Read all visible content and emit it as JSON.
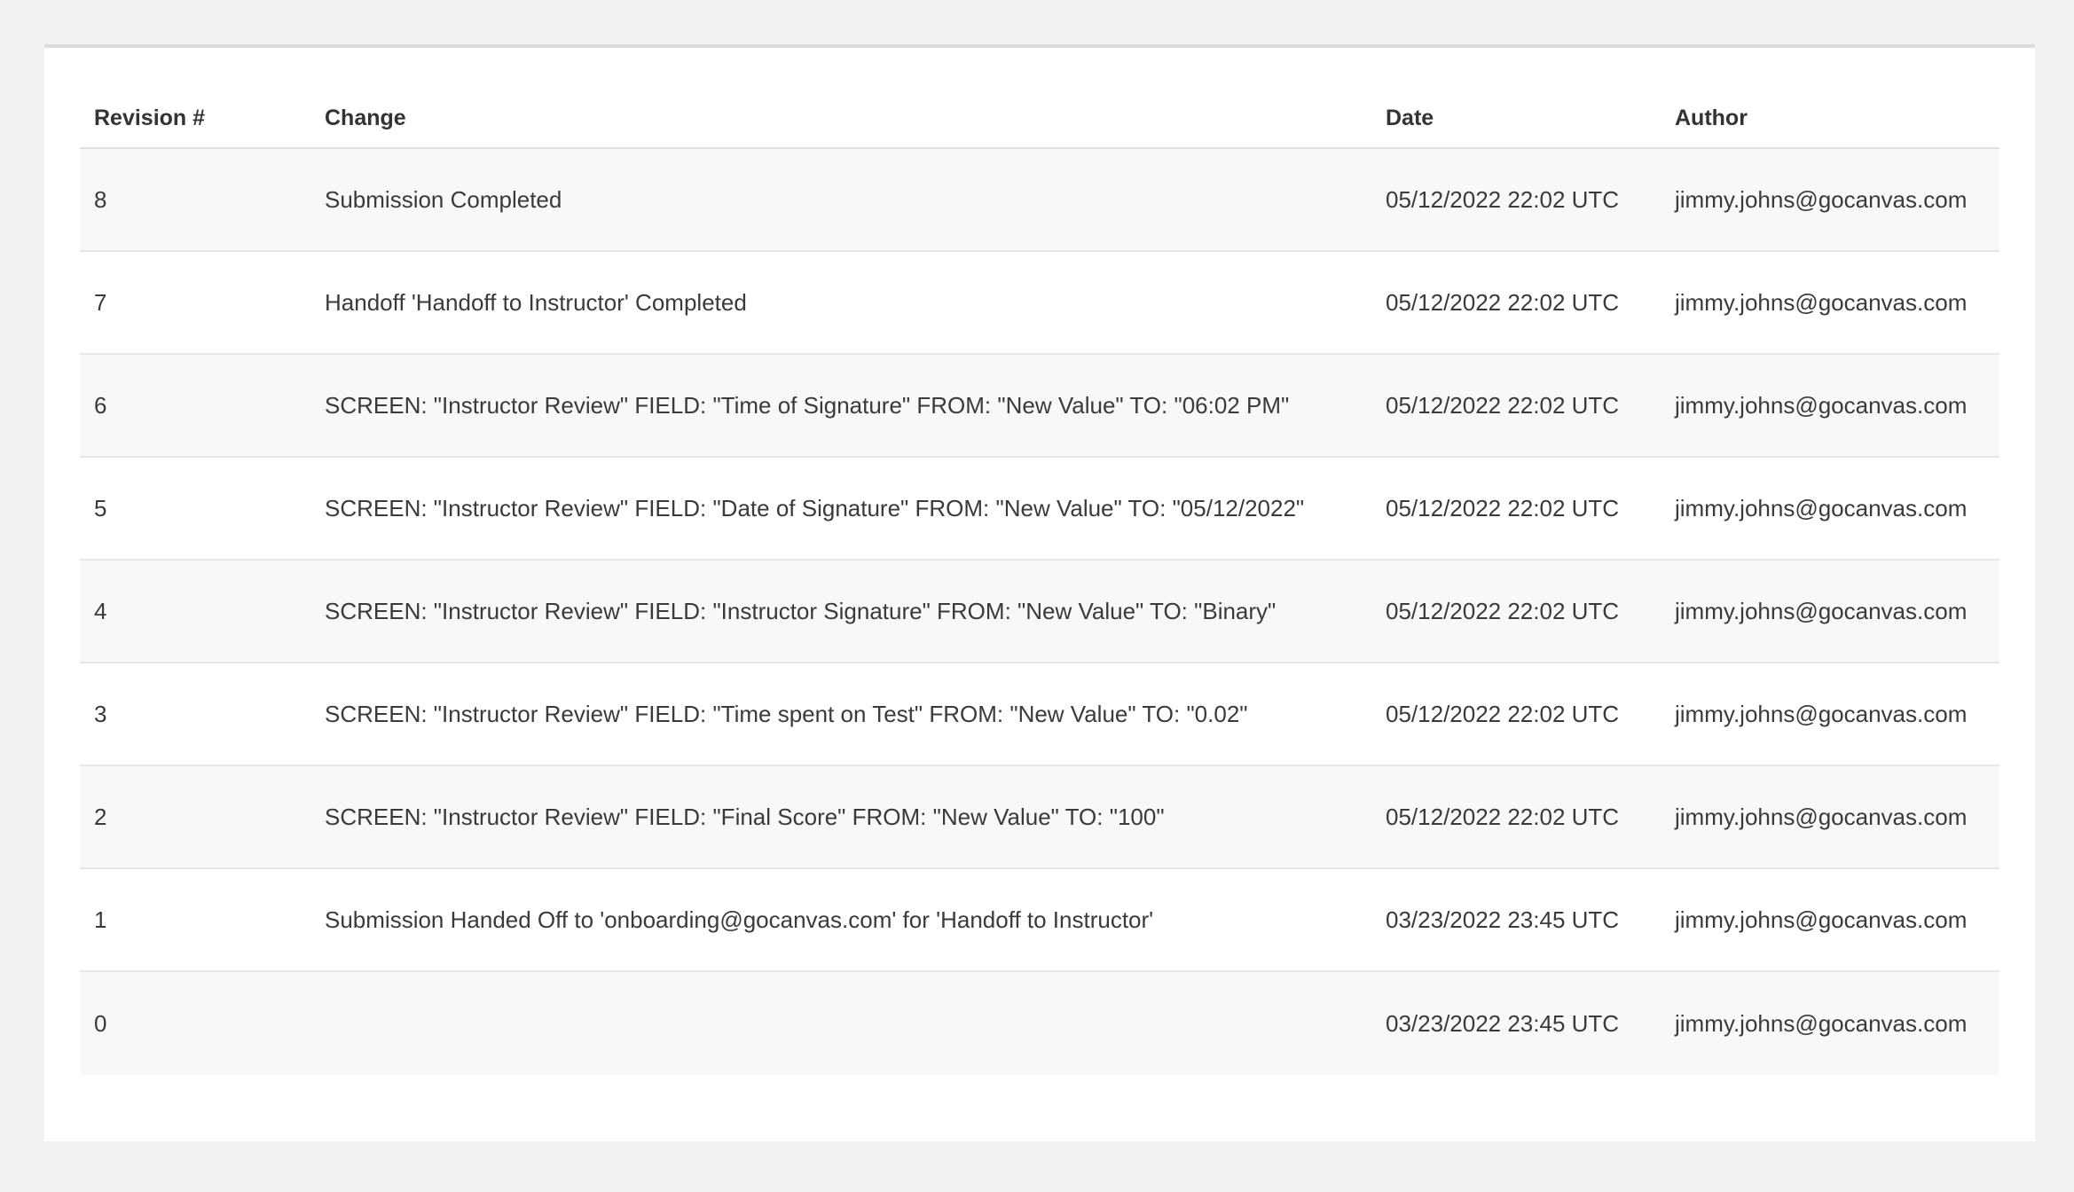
{
  "table": {
    "columns": {
      "revision": "Revision #",
      "change": "Change",
      "date": "Date",
      "author": "Author"
    },
    "rows": [
      {
        "revision": "8",
        "change": "Submission Completed",
        "date": "05/12/2022 22:02 UTC",
        "author": "jimmy.johns@gocanvas.com"
      },
      {
        "revision": "7",
        "change": "Handoff 'Handoff to Instructor' Completed",
        "date": "05/12/2022 22:02 UTC",
        "author": "jimmy.johns@gocanvas.com"
      },
      {
        "revision": "6",
        "change": "SCREEN: \"Instructor Review\" FIELD: \"Time of Signature\" FROM: \"New Value\" TO: \"06:02 PM\"",
        "date": "05/12/2022 22:02 UTC",
        "author": "jimmy.johns@gocanvas.com"
      },
      {
        "revision": "5",
        "change": "SCREEN: \"Instructor Review\" FIELD: \"Date of Signature\" FROM: \"New Value\" TO: \"05/12/2022\"",
        "date": "05/12/2022 22:02 UTC",
        "author": "jimmy.johns@gocanvas.com"
      },
      {
        "revision": "4",
        "change": "SCREEN: \"Instructor Review\" FIELD: \"Instructor Signature\" FROM: \"New Value\" TO: \"Binary\"",
        "date": "05/12/2022 22:02 UTC",
        "author": "jimmy.johns@gocanvas.com"
      },
      {
        "revision": "3",
        "change": "SCREEN: \"Instructor Review\" FIELD: \"Time spent on Test\" FROM: \"New Value\" TO: \"0.02\"",
        "date": "05/12/2022 22:02 UTC",
        "author": "jimmy.johns@gocanvas.com"
      },
      {
        "revision": "2",
        "change": "SCREEN: \"Instructor Review\" FIELD: \"Final Score\" FROM: \"New Value\" TO: \"100\"",
        "date": "05/12/2022 22:02 UTC",
        "author": "jimmy.johns@gocanvas.com"
      },
      {
        "revision": "1",
        "change": "Submission Handed Off to 'onboarding@gocanvas.com' for 'Handoff to Instructor'",
        "date": "03/23/2022 23:45 UTC",
        "author": "jimmy.johns@gocanvas.com"
      },
      {
        "revision": "0",
        "change": "",
        "date": "03/23/2022 23:45 UTC",
        "author": "jimmy.johns@gocanvas.com"
      }
    ]
  }
}
